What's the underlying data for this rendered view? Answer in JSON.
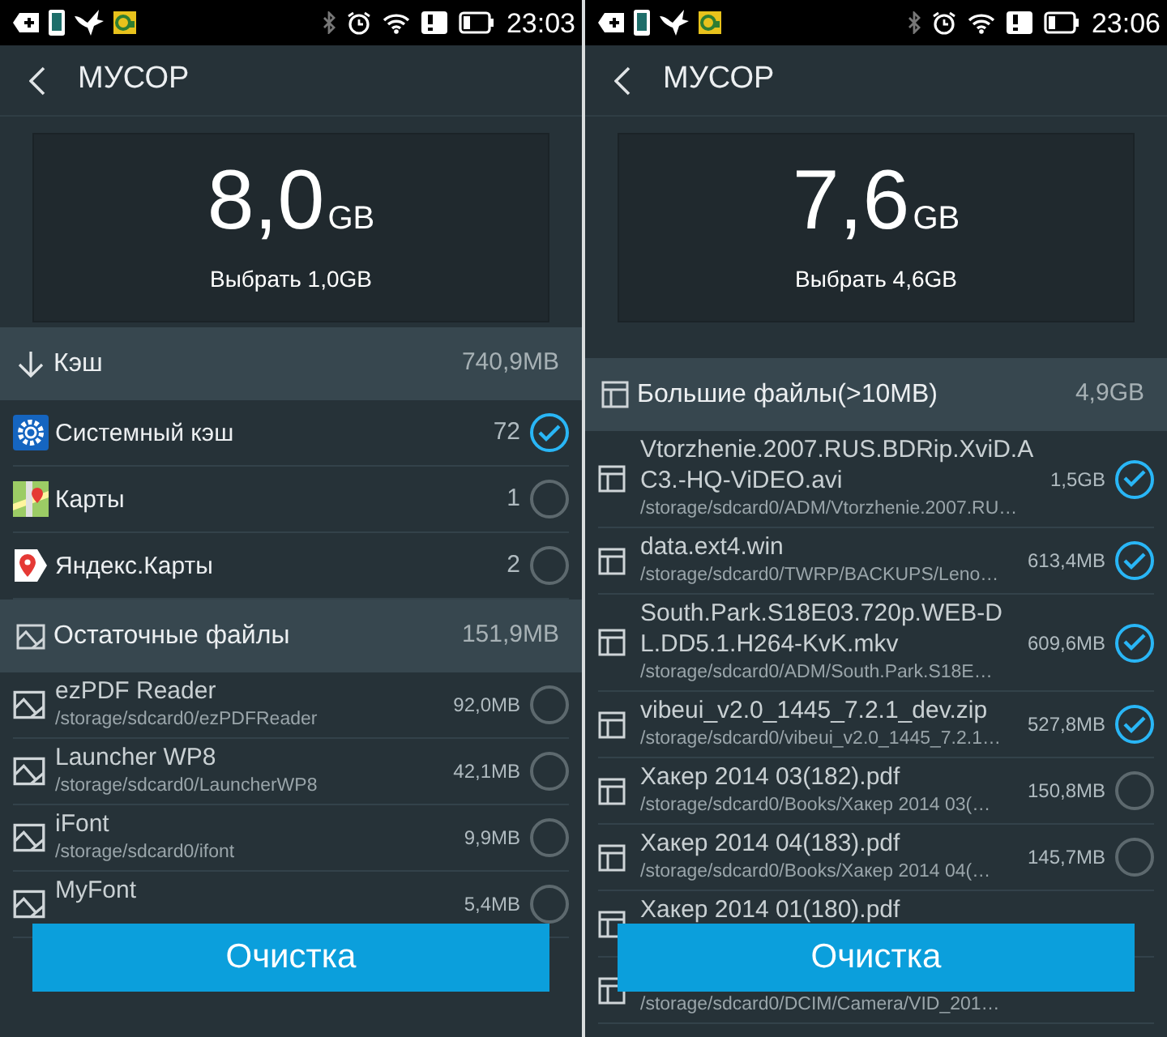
{
  "panels": [
    {
      "status_bar": {
        "time": "23:03"
      },
      "title": "МУСОР",
      "summary": {
        "total": "8,0",
        "unit": "GB",
        "selected": "Выбрать 1,0GB"
      },
      "sections": [
        {
          "kind": "cache",
          "title": "Кэш",
          "size": "740,9MB",
          "items": [
            {
              "name": "Системный кэш",
              "count": "72",
              "checked": true
            },
            {
              "name": "Карты",
              "count": "1",
              "checked": false
            },
            {
              "name": "Яндекс.Карты",
              "count": "2",
              "checked": false
            }
          ]
        },
        {
          "kind": "residual",
          "title": "Остаточные файлы",
          "size": "151,9MB",
          "items": [
            {
              "name": "ezPDF Reader",
              "path": "/storage/sdcard0/ezPDFReader",
              "size": "92,0MB",
              "checked": false
            },
            {
              "name": "Launcher WP8",
              "path": "/storage/sdcard0/LauncherWP8",
              "size": "42,1MB",
              "checked": false
            },
            {
              "name": "iFont",
              "path": "/storage/sdcard0/ifont",
              "size": "9,9MB",
              "checked": false
            },
            {
              "name": "MyFont",
              "size": "5,4MB",
              "checked": false
            }
          ]
        }
      ],
      "button": "Очистка"
    },
    {
      "status_bar": {
        "time": "23:06"
      },
      "title": "МУСОР",
      "summary": {
        "total": "7,6",
        "unit": "GB",
        "selected": "Выбрать 4,6GB"
      },
      "sections": [
        {
          "kind": "large",
          "title": "Большие файлы(>10MB)",
          "size": "4,9GB",
          "items": [
            {
              "name": "Vtorzhenie.2007.RUS.BDRip.XviD.AC3.-HQ-ViDEO.avi",
              "path": "/storage/sdcard0/ADM/Vtorzhenie.2007.RU…",
              "size": "1,5GB",
              "checked": true
            },
            {
              "name": "data.ext4.win",
              "path": "/storage/sdcard0/TWRP/BACKUPS/Leno…",
              "size": "613,4MB",
              "checked": true
            },
            {
              "name": "South.Park.S18E03.720p.WEB-DL.DD5.1.H264-KvK.mkv",
              "path": "/storage/sdcard0/ADM/South.Park.S18E…",
              "size": "609,6MB",
              "checked": true
            },
            {
              "name": "vibeui_v2.0_1445_7.2.1_dev.zip",
              "path": "/storage/sdcard0/vibeui_v2.0_1445_7.2.1…",
              "size": "527,8MB",
              "checked": true
            },
            {
              "name": "Хакер 2014 03(182).pdf",
              "path": "/storage/sdcard0/Books/Хакер 2014 03(…",
              "size": "150,8MB",
              "checked": false
            },
            {
              "name": "Хакер 2014 04(183).pdf",
              "path": "/storage/sdcard0/Books/Хакер 2014 04(…",
              "size": "145,7MB",
              "checked": false
            },
            {
              "name": "Хакер 2014 01(180).pdf"
            },
            {
              "path": "/storage/sdcard0/DCIM/Camera/VID_201…"
            }
          ]
        }
      ],
      "button": "Очистка"
    }
  ]
}
